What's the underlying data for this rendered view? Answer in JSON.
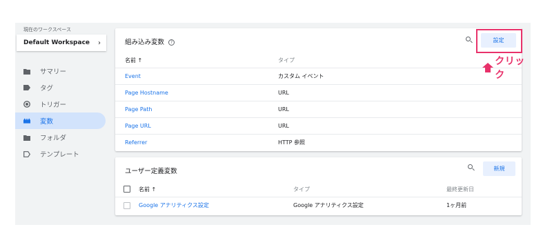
{
  "workspace": {
    "caption": "現在のワークスペース",
    "name": "Default Workspace",
    "chevron": "›"
  },
  "sidebar": {
    "items": [
      {
        "label": "サマリー",
        "icon": "folder-icon",
        "active": false
      },
      {
        "label": "タグ",
        "icon": "tag-icon",
        "active": false
      },
      {
        "label": "トリガー",
        "icon": "trigger-icon",
        "active": false
      },
      {
        "label": "変数",
        "icon": "variables-icon",
        "active": true
      },
      {
        "label": "フォルダ",
        "icon": "folder-icon",
        "active": false
      },
      {
        "label": "テンプレート",
        "icon": "template-icon",
        "active": false
      }
    ]
  },
  "builtin_vars": {
    "title": "組み込み変数",
    "help": "?",
    "configure_label": "設定",
    "columns": {
      "name": "名前 ↑",
      "type": "タイプ"
    },
    "rows": [
      {
        "name": "Event",
        "type": "カスタム イベント"
      },
      {
        "name": "Page Hostname",
        "type": "URL"
      },
      {
        "name": "Page Path",
        "type": "URL"
      },
      {
        "name": "Page URL",
        "type": "URL"
      },
      {
        "name": "Referrer",
        "type": "HTTP 参照"
      }
    ]
  },
  "annotation": {
    "text": "クリック",
    "color": "#e8316a"
  },
  "user_vars": {
    "title": "ユーザー定義変数",
    "new_label": "新規",
    "columns": {
      "name": "名前 ↑",
      "type": "タイプ",
      "edited": "最終更新日"
    },
    "rows": [
      {
        "name": "Google アナリティクス設定",
        "type": "Google アナリティクス設定",
        "edited": "1ヶ月前"
      }
    ]
  },
  "colors": {
    "accent": "#1a73e8",
    "active_bg": "#d2e3fc",
    "button_bg": "#e8f0fe",
    "highlight": "#e8316a"
  }
}
